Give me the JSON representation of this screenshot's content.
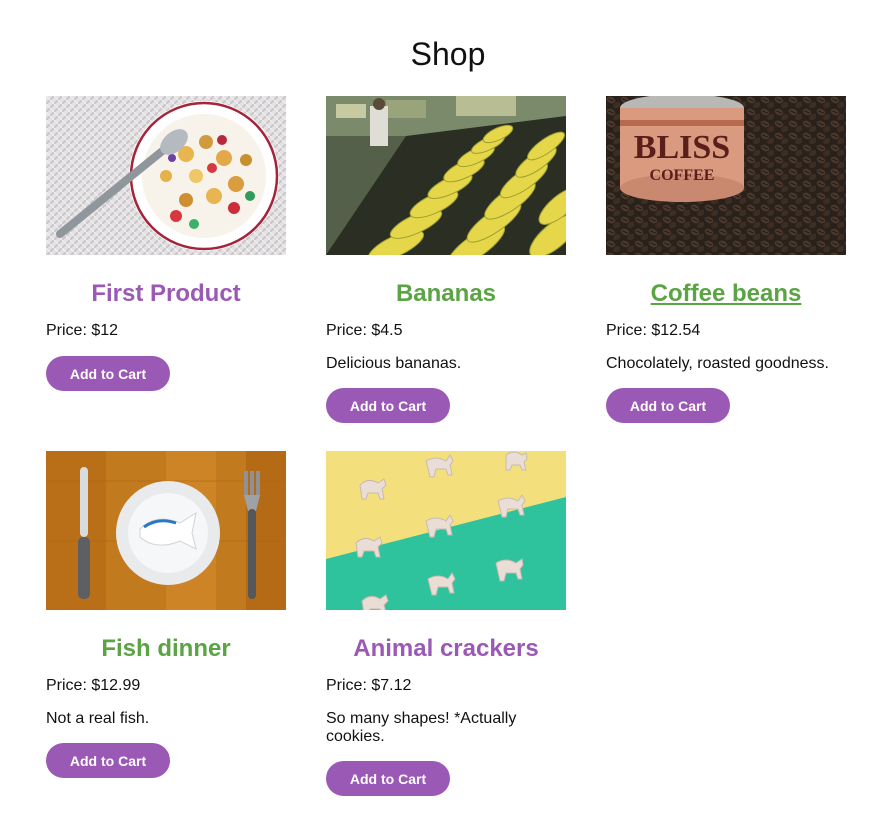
{
  "page": {
    "title": "Shop"
  },
  "colors": {
    "accent_purple": "#9b59b6",
    "accent_green": "#5aa444"
  },
  "products": [
    {
      "title": "First Product",
      "price": "Price: $12",
      "description": "",
      "button": "Add to Cart",
      "title_color": "purple",
      "image": "cereal-bowl-image"
    },
    {
      "title": "Bananas",
      "price": "Price: $4.5",
      "description": "Delicious bananas.",
      "button": "Add to Cart",
      "title_color": "green",
      "image": "bananas-image"
    },
    {
      "title": "Coffee beans",
      "price": "Price: $12.54",
      "description": "Chocolately, roasted goodness.",
      "button": "Add to Cart",
      "title_color": "green",
      "image": "coffee-beans-image"
    },
    {
      "title": "Fish dinner",
      "price": "Price: $12.99",
      "description": "Not a real fish.",
      "button": "Add to Cart",
      "title_color": "green",
      "image": "fish-dinner-image"
    },
    {
      "title": "Animal crackers",
      "price": "Price: $7.12",
      "description": "So many shapes! *Actually cookies.",
      "button": "Add to Cart",
      "title_color": "purple",
      "image": "animal-crackers-image"
    }
  ]
}
